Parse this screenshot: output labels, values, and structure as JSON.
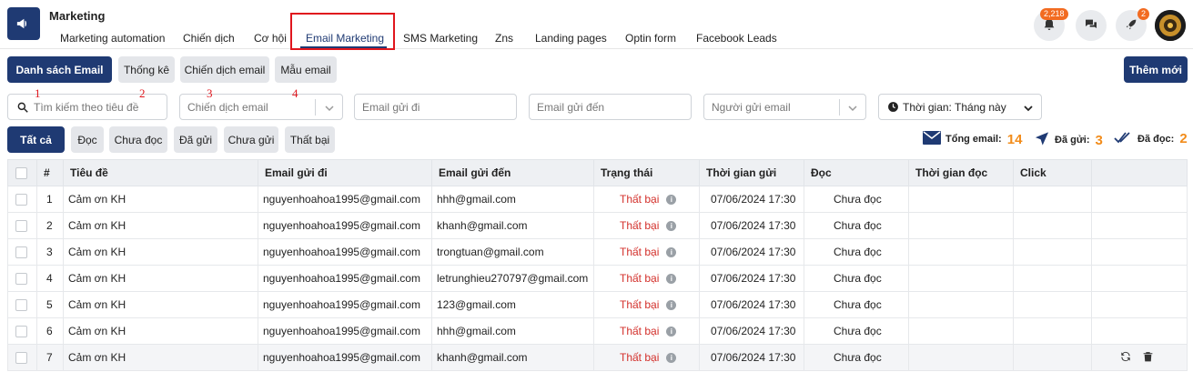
{
  "header": {
    "title": "Marketing",
    "tabs": [
      {
        "label": "Marketing automation"
      },
      {
        "label": "Chiến dịch"
      },
      {
        "label": "Cơ hội"
      },
      {
        "label": "Email Marketing"
      },
      {
        "label": "SMS Marketing"
      },
      {
        "label": "Zns"
      },
      {
        "label": "Landing pages"
      },
      {
        "label": "Optin form"
      },
      {
        "label": "Facebook Leads"
      }
    ],
    "active_tab": "Email Marketing",
    "notification_count": "2,218",
    "rocket_count": "2"
  },
  "toolbar": {
    "list_label": "Danh sách Email",
    "stats_label": "Thống kê",
    "campaign_label": "Chiến dịch email",
    "template_label": "Mẫu email",
    "add_label": "Thêm mới"
  },
  "filters": {
    "search_placeholder": "Tìm kiếm theo tiêu đề",
    "campaign_placeholder": "Chiến dịch email",
    "from_placeholder": "Email gửi đi",
    "to_placeholder": "Email gửi đến",
    "sender_placeholder": "Người gửi email",
    "time_label": "Thời gian: Tháng này",
    "marks": [
      "1",
      "2",
      "3",
      "4"
    ]
  },
  "status_tabs": [
    "Tất cả",
    "Đọc",
    "Chưa đọc",
    "Đã gửi",
    "Chưa gửi",
    "Thất bại"
  ],
  "stats": {
    "total_label": "Tổng email:",
    "total": "14",
    "sent_label": "Đã gửi:",
    "sent": "3",
    "read_label": "Đã đọc:",
    "read": "2"
  },
  "table": {
    "columns": [
      "#",
      "Tiêu đề",
      "Email gửi đi",
      "Email gửi đến",
      "Trạng thái",
      "Thời gian gửi",
      "Đọc",
      "Thời gian đọc",
      "Click",
      ""
    ],
    "rows": [
      {
        "num": "1",
        "title": "Cảm ơn KH",
        "from": "nguyenhoahoa1995@gmail.com",
        "to": "hhh@gmail.com",
        "status": "Thất bại",
        "sent_time": "07/06/2024 17:30",
        "read": "Chưa đọc"
      },
      {
        "num": "2",
        "title": "Cảm ơn KH",
        "from": "nguyenhoahoa1995@gmail.com",
        "to": "khanh@gmail.com",
        "status": "Thất bại",
        "sent_time": "07/06/2024 17:30",
        "read": "Chưa đọc"
      },
      {
        "num": "3",
        "title": "Cảm ơn KH",
        "from": "nguyenhoahoa1995@gmail.com",
        "to": "trongtuan@gmail.com",
        "status": "Thất bại",
        "sent_time": "07/06/2024 17:30",
        "read": "Chưa đọc"
      },
      {
        "num": "4",
        "title": "Cảm ơn KH",
        "from": "nguyenhoahoa1995@gmail.com",
        "to": "letrunghieu270797@gmail.com",
        "status": "Thất bại",
        "sent_time": "07/06/2024 17:30",
        "read": "Chưa đọc"
      },
      {
        "num": "5",
        "title": "Cảm ơn KH",
        "from": "nguyenhoahoa1995@gmail.com",
        "to": "123@gmail.com",
        "status": "Thất bại",
        "sent_time": "07/06/2024 17:30",
        "read": "Chưa đọc"
      },
      {
        "num": "6",
        "title": "Cảm ơn KH",
        "from": "nguyenhoahoa1995@gmail.com",
        "to": "hhh@gmail.com",
        "status": "Thất bại",
        "sent_time": "07/06/2024 17:30",
        "read": "Chưa đọc"
      },
      {
        "num": "7",
        "title": "Cảm ơn KH",
        "from": "nguyenhoahoa1995@gmail.com",
        "to": "khanh@gmail.com",
        "status": "Thất bại",
        "sent_time": "07/06/2024 17:30",
        "read": "Chưa đọc"
      }
    ]
  },
  "colors": {
    "primary": "#1f3a73",
    "accent_orange": "#f28c1b",
    "fail_red": "#d3302b",
    "highlight_box": "#e0161d"
  },
  "icons": {
    "logo": "megaphone-icon",
    "search": "search-icon",
    "bell": "bell-icon",
    "chat": "chat-icon",
    "rocket": "rocket-icon",
    "clock": "clock-icon",
    "envelope": "envelope-icon",
    "sent": "paper-plane-icon",
    "read": "double-check-icon",
    "refresh": "refresh-icon",
    "delete": "trash-icon"
  }
}
